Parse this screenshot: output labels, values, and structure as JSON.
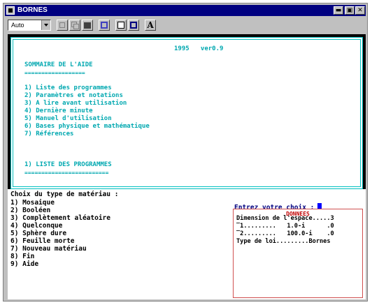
{
  "window": {
    "title": "BORNES"
  },
  "titlebar_buttons": [
    "▬",
    "▣",
    "✕"
  ],
  "toolbar": {
    "font_select": "Auto",
    "a_button": "A"
  },
  "help": {
    "header": "1995   ver0.9",
    "title": "SOMMAIRE DE L'AIDE",
    "title_underline": "==================",
    "items": [
      "1) Liste des programmes",
      "2) Paramètres et notations",
      "3) A lire avant utilisation",
      "4) Dernière minute",
      "5) Manuel d'utilisation",
      "6) Bases physique et mathématique",
      "7) Références"
    ],
    "section": "1) LISTE DES PROGRAMMES",
    "section_underline": "========================="
  },
  "menu": {
    "heading": "Choix du type de matériau :",
    "items": [
      "1) Mosaique",
      "2) Booléen",
      "3) Complètement aléatoire",
      "4) Quelconque",
      "5) Sphère dure",
      "6) Feuille morte",
      "7) Nouveau matériau",
      "8) Fin",
      "9) Aide"
    ]
  },
  "prompt": "Entrez votre choix :",
  "donnees": {
    "label": "DONNEES",
    "lines": [
      "Dimension de l'espace.....3",
      "‾1.........   1.0-i      .0",
      "‾2.........   100.0-i    .0",
      "Type de loi.........Bornes"
    ]
  },
  "colors": {
    "cyan_text": "#00a8b0",
    "prompt": "#000080",
    "cursor": "#0000ff",
    "donnees_border": "#d05050"
  }
}
